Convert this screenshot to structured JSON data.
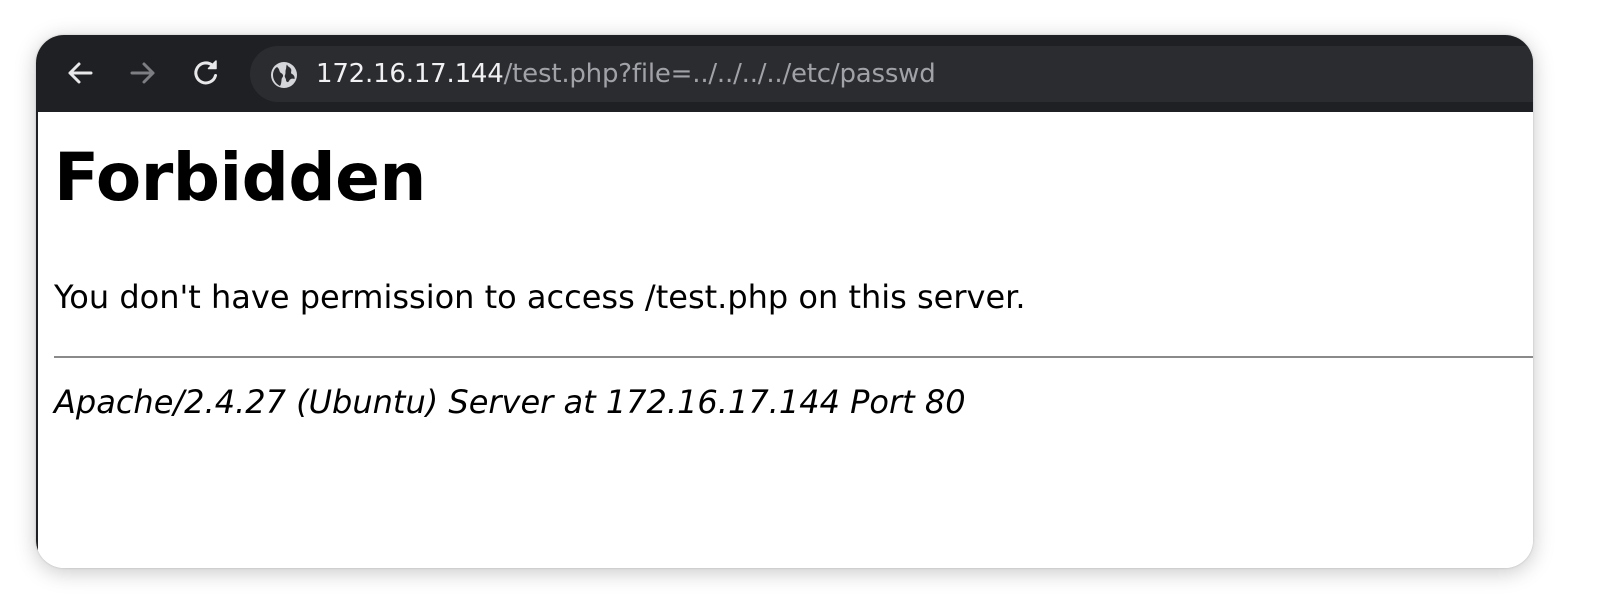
{
  "browser": {
    "toolbar_color": "#1f2023",
    "omnibox_color": "#2b2c30",
    "nav": {
      "back_icon": "arrow-left-icon",
      "forward_icon": "arrow-right-icon",
      "reload_icon": "reload-icon",
      "forward_enabled": false
    },
    "address_bar": {
      "site_info_icon": "globe-icon",
      "host": "172.16.17.144",
      "path": "/test.php?file=../../../../etc/passwd"
    }
  },
  "page": {
    "title": "Forbidden",
    "message": "You don't have permission to access /test.php on this server.",
    "server_signature": "Apache/2.4.27 (Ubuntu) Server at 172.16.17.144 Port 80"
  }
}
